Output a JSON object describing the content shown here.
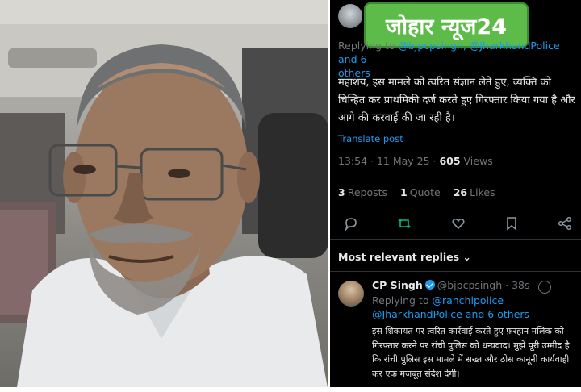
{
  "watermark": {
    "text": "जोहार न्यूज24",
    "color": "#5dbb49"
  },
  "tweet": {
    "replying_prefix": "Replying to ",
    "replying_links": "@bjpcpsingh, @JharkhandPolice and 6",
    "replying_suffix": "others",
    "body": "महाशय, इस मामले को त्वरित संज्ञान लेते हुए, व्यक्ति को चिन्हित कर प्राथमिकी दर्ज करते हुए गिरफ्तार किया गया है और आगे की करवाई की जा रही है।",
    "translate_label": "Translate post",
    "time": "13:54 · 11 May 25 · ",
    "views_count": "605",
    "views_label": " Views",
    "reposts_count": "3",
    "reposts_label": "Reposts",
    "quotes_count": "1",
    "quotes_label": "Quote",
    "likes_count": "26",
    "likes_label": "Likes",
    "action_icons": [
      "reply-icon",
      "repost-icon",
      "like-icon",
      "bookmark-icon",
      "share-icon"
    ],
    "accent_color": "#1d9bf0",
    "repost_color": "#00ba7c"
  },
  "replies": {
    "header": "Most relevant replies ⌄",
    "reply": {
      "name": "CP Singh",
      "handle": "@bjpcpsingh · 38s",
      "replying_prefix": "Replying to ",
      "replying_link1": "@ranchipolice",
      "replying_link2": "@JharkhandPolice and 6 others",
      "text": "इस शिकायत पर त्वरित कार्रवाई करते हुए फ़रहान मलिक को गिरफ्तार करने पर रांची पुलिस को धन्यवाद। मुझे पूरी उम्मीद है कि रांची पुलिस इस मामले में सख्त और ठोस कानूनी कार्यवाही कर एक मजबूत संदेश देगी।"
    }
  }
}
